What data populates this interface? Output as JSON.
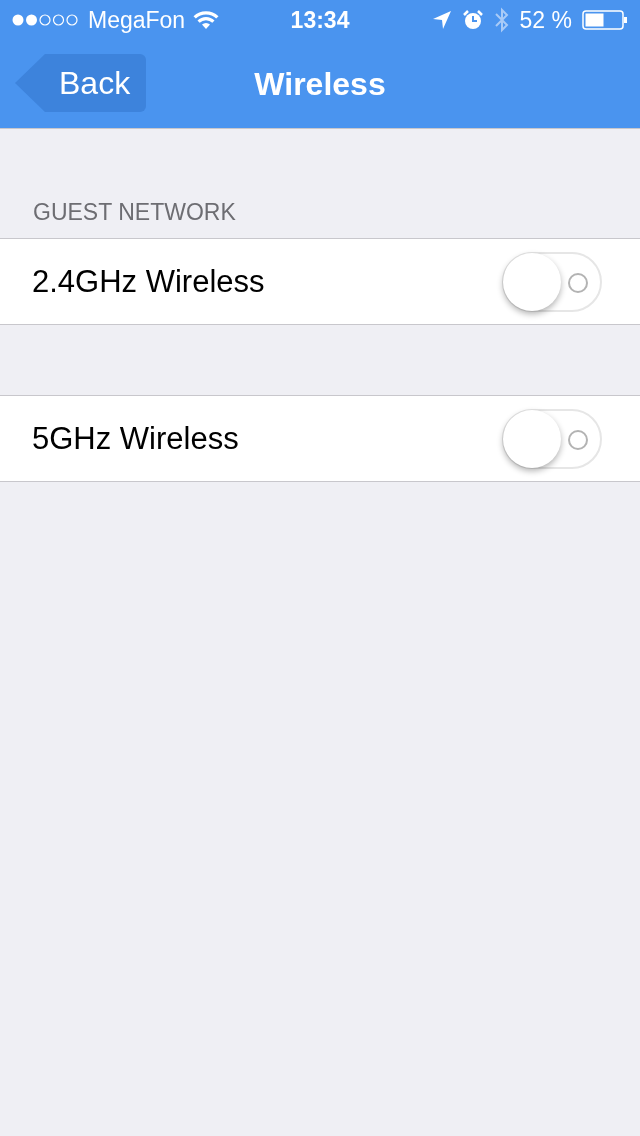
{
  "status_bar": {
    "carrier": "MegaFon",
    "time": "13:34",
    "battery": "52 %"
  },
  "nav_bar": {
    "back": "Back",
    "title": "Wireless"
  },
  "sections": [
    {
      "header": "GUEST NETWORK",
      "rows": [
        {
          "label": "2.4GHz Wireless",
          "on": false
        }
      ]
    },
    {
      "rows": [
        {
          "label": "5GHz Wireless",
          "on": false
        }
      ]
    }
  ]
}
